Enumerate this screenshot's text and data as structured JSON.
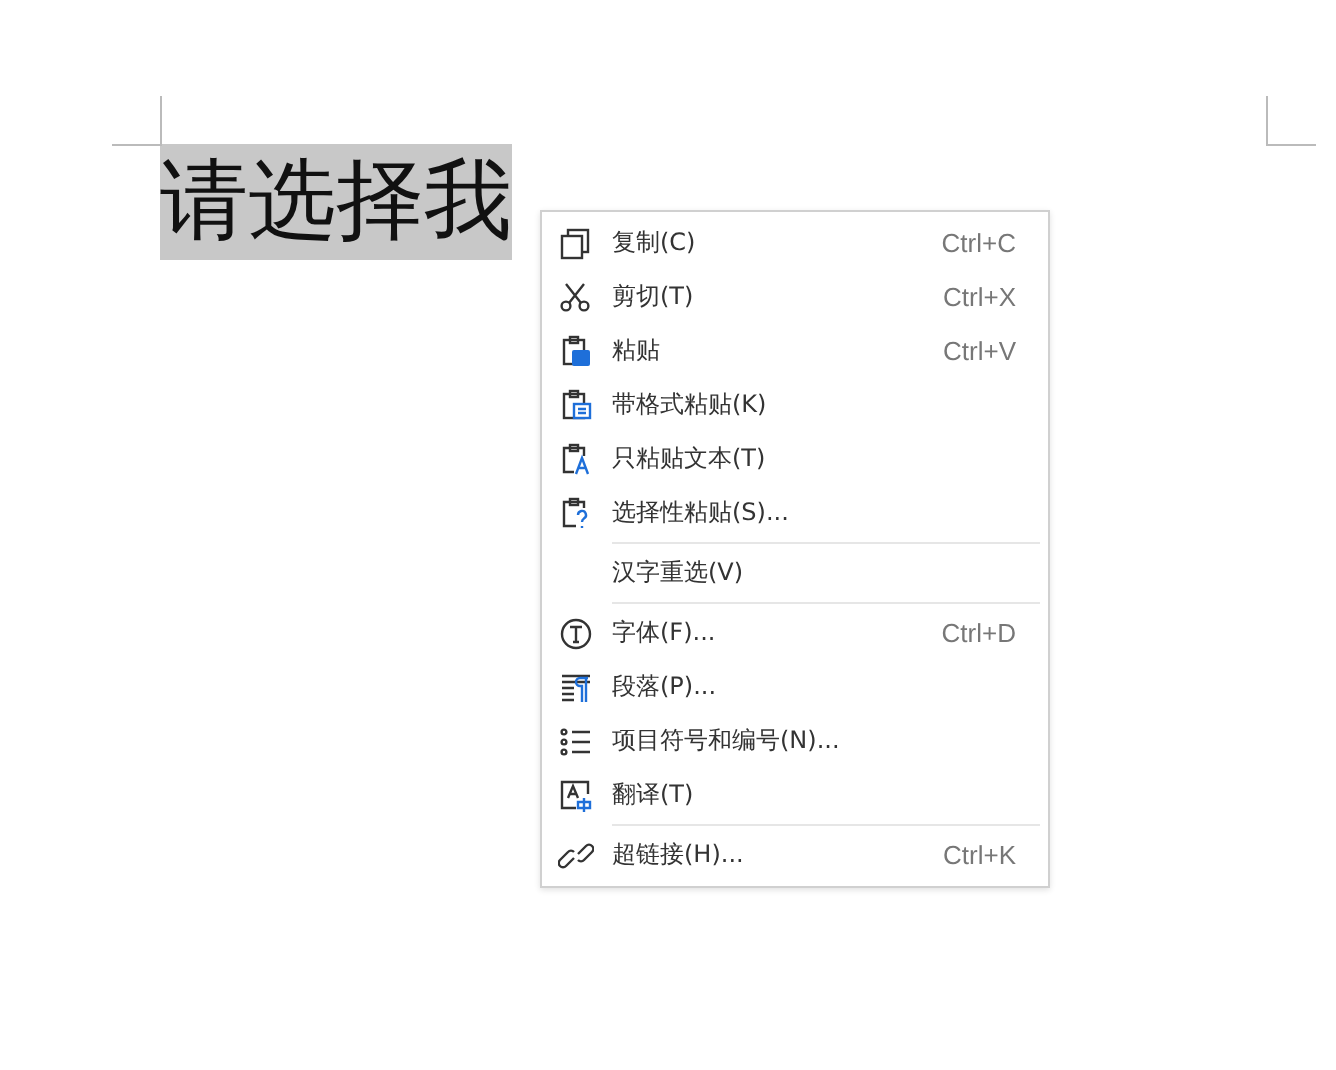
{
  "document": {
    "selected_text": "请选择我"
  },
  "context_menu": {
    "items": [
      {
        "kind": "item",
        "label": "复制(C)",
        "shortcut": "Ctrl+C"
      },
      {
        "kind": "item",
        "label": "剪切(T)",
        "shortcut": "Ctrl+X"
      },
      {
        "kind": "item",
        "label": "粘贴",
        "shortcut": "Ctrl+V"
      },
      {
        "kind": "item",
        "label": "带格式粘贴(K)"
      },
      {
        "kind": "item",
        "label": "只粘贴文本(T)"
      },
      {
        "kind": "item",
        "label": "选择性粘贴(S)..."
      },
      {
        "kind": "separator"
      },
      {
        "kind": "item",
        "label": "汉字重选(V)"
      },
      {
        "kind": "separator"
      },
      {
        "kind": "item",
        "label": "字体(F)...",
        "shortcut": "Ctrl+D"
      },
      {
        "kind": "item",
        "label": "段落(P)..."
      },
      {
        "kind": "item",
        "label": "项目符号和编号(N)..."
      },
      {
        "kind": "item",
        "label": "翻译(T)"
      },
      {
        "kind": "separator"
      },
      {
        "kind": "item",
        "label": "超链接(H)...",
        "shortcut": "Ctrl+K"
      }
    ]
  }
}
